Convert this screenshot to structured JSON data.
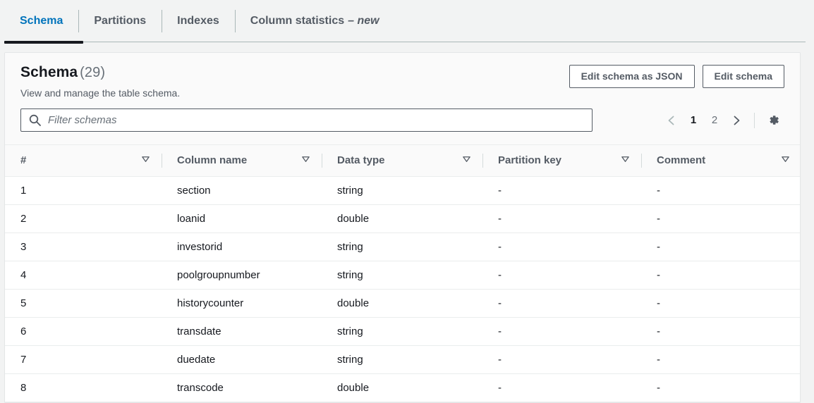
{
  "tabs": [
    {
      "label": "Schema",
      "active": true
    },
    {
      "label": "Partitions",
      "active": false
    },
    {
      "label": "Indexes",
      "active": false
    },
    {
      "label": "Column statistics",
      "suffix": "– new",
      "active": false
    }
  ],
  "panel": {
    "title": "Schema",
    "count": "(29)",
    "subtitle": "View and manage the table schema.",
    "buttons": {
      "edit_json": "Edit schema as JSON",
      "edit_schema": "Edit schema"
    }
  },
  "search": {
    "placeholder": "Filter schemas",
    "value": "",
    "icon": "search-icon"
  },
  "pagination": {
    "prev_icon": "chevron-left-icon",
    "next_icon": "chevron-right-icon",
    "pages": [
      "1",
      "2"
    ],
    "current": "1",
    "settings_icon": "gear-icon"
  },
  "table": {
    "columns": [
      {
        "label": "#",
        "sort_icon": "sort-triangle-icon"
      },
      {
        "label": "Column name",
        "sort_icon": "sort-triangle-icon"
      },
      {
        "label": "Data type",
        "sort_icon": "sort-triangle-icon"
      },
      {
        "label": "Partition key",
        "sort_icon": "sort-triangle-icon"
      },
      {
        "label": "Comment",
        "sort_icon": "sort-triangle-icon"
      }
    ],
    "rows": [
      {
        "num": "1",
        "name": "section",
        "type": "string",
        "partition_key": "-",
        "comment": "-"
      },
      {
        "num": "2",
        "name": "loanid",
        "type": "double",
        "partition_key": "-",
        "comment": "-"
      },
      {
        "num": "3",
        "name": "investorid",
        "type": "string",
        "partition_key": "-",
        "comment": "-"
      },
      {
        "num": "4",
        "name": "poolgroupnumber",
        "type": "string",
        "partition_key": "-",
        "comment": "-"
      },
      {
        "num": "5",
        "name": "historycounter",
        "type": "double",
        "partition_key": "-",
        "comment": "-"
      },
      {
        "num": "6",
        "name": "transdate",
        "type": "string",
        "partition_key": "-",
        "comment": "-"
      },
      {
        "num": "7",
        "name": "duedate",
        "type": "string",
        "partition_key": "-",
        "comment": "-"
      },
      {
        "num": "8",
        "name": "transcode",
        "type": "double",
        "partition_key": "-",
        "comment": "-"
      }
    ]
  },
  "colors": {
    "accent": "#0073bb",
    "text": "#16191f",
    "muted": "#545b64",
    "border": "#eaeded",
    "page_bg": "#f2f3f3",
    "header_bg": "#fafafa"
  }
}
